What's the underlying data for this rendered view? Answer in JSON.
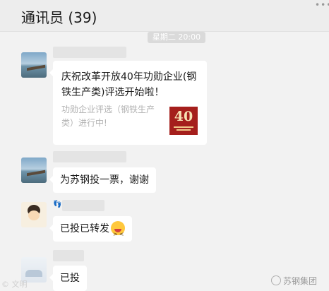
{
  "header": {
    "title": "通讯员 (39)",
    "more_icon": "more-dots-icon"
  },
  "timestamp": "星期二 20:00",
  "messages": [
    {
      "type": "link-card",
      "avatar": "sea-pier-avatar",
      "title": "庆祝改革开放40年功勋企业(钢铁生产类)评选开始啦！",
      "description": "功勋企业评选（钢铁生产类）进行中!",
      "thumbnail_text": "40"
    },
    {
      "type": "text",
      "avatar": "sea-pier-avatar",
      "text": "为苏钢投一票，谢谢"
    },
    {
      "type": "text",
      "avatar": "cartoon-girl-avatar",
      "text": "已投已转发",
      "emoji": "squint-laugh-emoji"
    },
    {
      "type": "text",
      "avatar": "light-avatar",
      "text": "已投"
    }
  ],
  "watermark": {
    "left": "© 文明",
    "right": "苏钢集团"
  },
  "colors": {
    "background": "#f2f2f2",
    "bubble": "#ffffff",
    "thumbnail": "#a51f1c"
  }
}
